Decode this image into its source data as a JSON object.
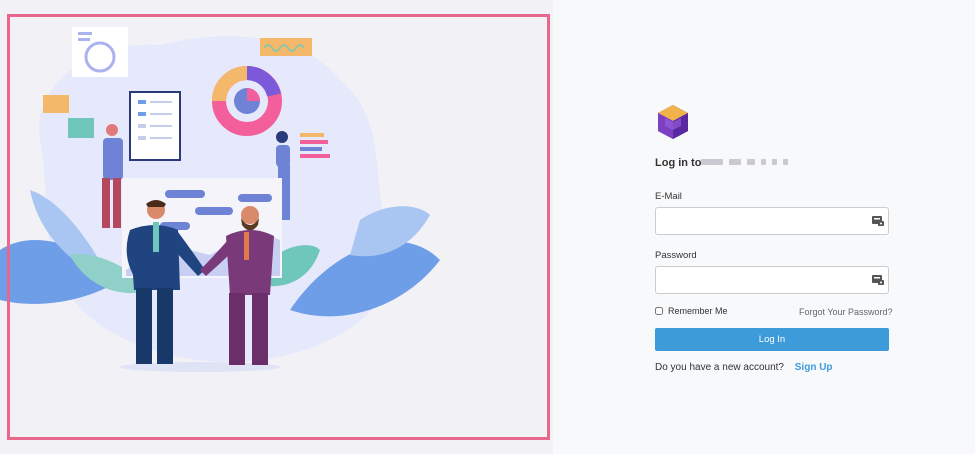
{
  "login": {
    "title": "Log in to",
    "email_label": "E-Mail",
    "email_value": "",
    "password_label": "Password",
    "password_value": "",
    "remember_label": "Remember Me",
    "remember_checked": false,
    "forgot_label": "Forgot Your Password?",
    "submit_label": "Log In",
    "new_account_text": "Do you have a new account?",
    "signup_label": "Sign Up"
  },
  "icons": {
    "logo": "cube-logo-icon",
    "field_key": "key-icon"
  },
  "colors": {
    "accent": "#3d9bda",
    "frame": "#e9668d",
    "logo": "#7b3fc2"
  }
}
